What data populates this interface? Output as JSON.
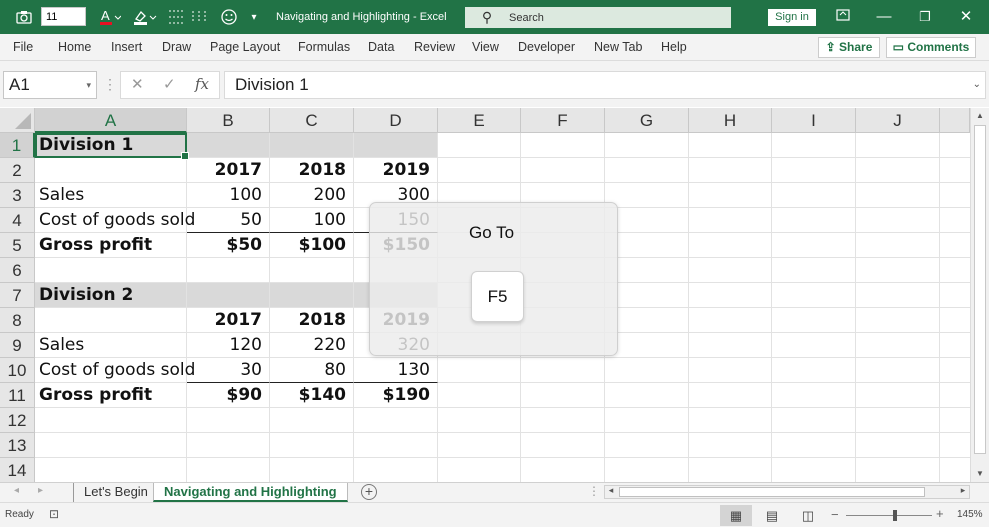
{
  "titlebar": {
    "font_size_value": "11",
    "document_title": "Navigating and Highlighting - Excel",
    "search_placeholder": "Search",
    "signin_label": "Sign in",
    "icons": [
      "camera-icon",
      "font-color-icon",
      "highlight-color-icon",
      "borders-icon",
      "emoji-icon",
      "qat-customize-icon",
      "ribbon-display-icon",
      "minimize-icon",
      "restore-icon",
      "close-icon"
    ]
  },
  "menu": {
    "items": [
      "File",
      "Home",
      "Insert",
      "Draw",
      "Page Layout",
      "Formulas",
      "Data",
      "Review",
      "View",
      "Developer",
      "New Tab",
      "Help"
    ],
    "share_label": "Share",
    "comments_label": "Comments"
  },
  "formula_bar": {
    "name_box": "A1",
    "cancel_symbol": "✕",
    "enter_symbol": "✓",
    "fx_symbol": "fx",
    "content": "Division 1"
  },
  "grid": {
    "columns": [
      "A",
      "B",
      "C",
      "D",
      "E",
      "F",
      "G",
      "H",
      "I",
      "J"
    ],
    "rows": [
      "1",
      "2",
      "3",
      "4",
      "5",
      "6",
      "7",
      "8",
      "9",
      "10",
      "11",
      "12",
      "13",
      "14"
    ],
    "selected_cell": "A1",
    "cells": {
      "r1": [
        "Division 1",
        "",
        "",
        ""
      ],
      "r2": [
        "",
        "2017",
        "2018",
        "2019"
      ],
      "r3": [
        "Sales",
        "100",
        "200",
        "300"
      ],
      "r4": [
        "Cost of goods sold",
        "50",
        "100",
        "150"
      ],
      "r5": [
        "Gross profit",
        "$50",
        "$100",
        "$150"
      ],
      "r7": [
        "Division 2",
        "",
        "",
        ""
      ],
      "r8": [
        "",
        "2017",
        "2018",
        "2019"
      ],
      "r9": [
        "Sales",
        "120",
        "220",
        "320"
      ],
      "r10": [
        "Cost of goods sold",
        "30",
        "80",
        "130"
      ],
      "r11": [
        "Gross profit",
        "$90",
        "$140",
        "$190"
      ]
    },
    "band_color": "#d9d9d9"
  },
  "overlay": {
    "title": "Go To",
    "key": "F5"
  },
  "sheets": {
    "tabs": [
      "Let's Begin",
      "Navigating and Highlighting"
    ],
    "active": "Navigating and Highlighting",
    "add_symbol": "+"
  },
  "status": {
    "ready": "Ready",
    "zoom": "145%",
    "zoom_minus": "−",
    "zoom_plus": "+"
  },
  "colors": {
    "excel_green": "#217346"
  }
}
